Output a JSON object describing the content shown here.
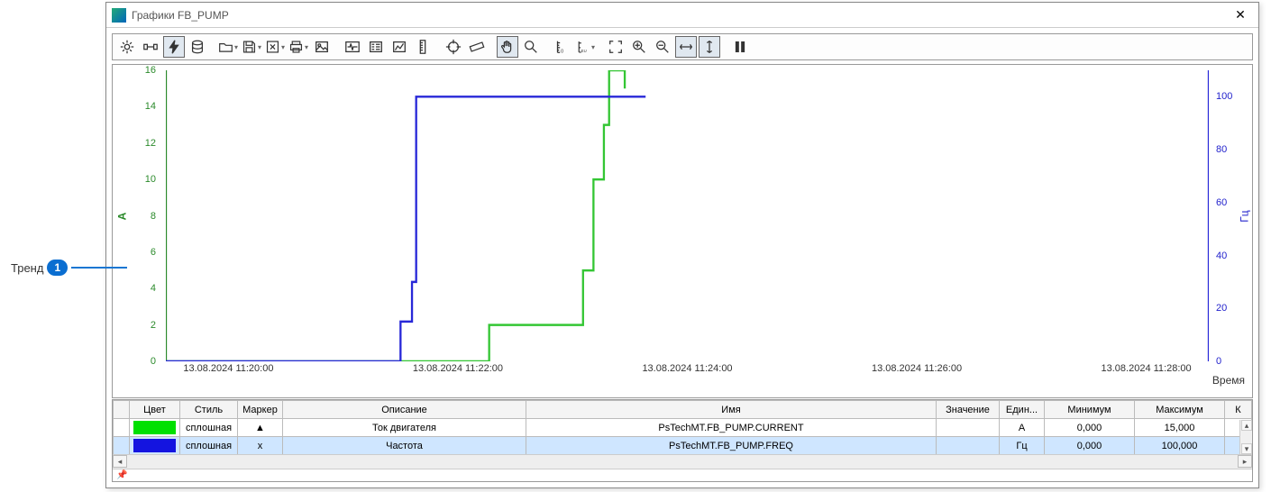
{
  "callout": {
    "label": "Тренд",
    "num": "1"
  },
  "window": {
    "title": "Графики FB_PUMP"
  },
  "chart_data": {
    "type": "line",
    "xlabel": "Время",
    "x_ticks": [
      "13.08.2024 11:20:00",
      "13.08.2024 11:22:00",
      "13.08.2024 11:24:00",
      "13.08.2024 11:26:00",
      "13.08.2024 11:28:00"
    ],
    "left_axis": {
      "label": "A",
      "ylim": [
        0,
        16
      ],
      "ticks": [
        0,
        2,
        4,
        6,
        8,
        10,
        12,
        14,
        16
      ],
      "color": "#2b8a2b"
    },
    "right_axis": {
      "label": "Гц",
      "ylim": [
        0,
        110
      ],
      "ticks": [
        0,
        20,
        40,
        60,
        80,
        100
      ],
      "color": "#2222cc"
    },
    "series": [
      {
        "name": "Ток двигателя",
        "axis": "left",
        "color": "#34c634",
        "points": [
          [
            0,
            0
          ],
          [
            0.31,
            0
          ],
          [
            0.31,
            2
          ],
          [
            0.4,
            2
          ],
          [
            0.4,
            5
          ],
          [
            0.41,
            5
          ],
          [
            0.41,
            10
          ],
          [
            0.42,
            10
          ],
          [
            0.42,
            13
          ],
          [
            0.425,
            13
          ],
          [
            0.425,
            16
          ],
          [
            0.44,
            16
          ],
          [
            0.44,
            15
          ]
        ]
      },
      {
        "name": "Частота",
        "axis": "right",
        "color": "#2828d8",
        "points": [
          [
            0,
            0
          ],
          [
            0.225,
            0
          ],
          [
            0.225,
            15
          ],
          [
            0.236,
            15
          ],
          [
            0.236,
            30
          ],
          [
            0.24,
            30
          ],
          [
            0.24,
            100
          ],
          [
            0.46,
            100
          ]
        ]
      }
    ]
  },
  "legend": {
    "headers": {
      "toggle": "",
      "color": "Цвет",
      "style": "Стиль",
      "marker": "Маркер",
      "desc": "Описание",
      "name": "Имя",
      "value": "Значение",
      "unit": "Един...",
      "min": "Минимум",
      "max": "Максимум",
      "k": "К"
    },
    "rows": [
      {
        "color": "#00e000",
        "style": "сплошная",
        "marker": "▲",
        "desc": "Ток двигателя",
        "name": "PsTechMT.FB_PUMP.CURRENT",
        "value": "",
        "unit": "A",
        "min": "0,000",
        "max": "15,000"
      },
      {
        "color": "#1414e0",
        "style": "сплошная",
        "marker": "x",
        "desc": "Частота",
        "name": "PsTechMT.FB_PUMP.FREQ",
        "value": "",
        "unit": "Гц",
        "min": "0,000",
        "max": "100,000"
      }
    ]
  },
  "icons": {
    "gear": "gear",
    "connect": "connect",
    "lightning": "lightning",
    "db": "db",
    "open": "open",
    "save": "save",
    "excel": "excel",
    "print": "print",
    "image": "image",
    "pulse": "pulse",
    "legend": "legend",
    "chart": "chart",
    "ruler-v": "rulerv",
    "target": "target",
    "ruler": "ruler",
    "hand": "hand",
    "zoom": "zoom",
    "scale-left": "sl",
    "scale-eu": "se",
    "fit": "fit",
    "zoom-in": "zi",
    "zoom-out": "zo",
    "fit-h": "fh",
    "fit-v": "fv",
    "pause": "pause"
  }
}
